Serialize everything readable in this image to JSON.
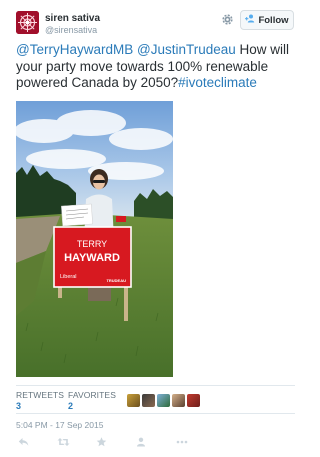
{
  "user": {
    "display_name": "siren sativa",
    "screen_name": "@sirensativa",
    "avatar_icon": "avatar-icon"
  },
  "header": {
    "settings_icon": "gear-icon",
    "follow_label": "Follow",
    "follow_icon": "add-user-icon"
  },
  "tweet": {
    "mention_1": "@TerryHaywardMB",
    "mention_2": "@JustinTrudeau",
    "body": " How will your party move towards 100% renewable powered Canada by 2050?",
    "hashtag": "#ivoteclimate"
  },
  "photo": {
    "sign_name_line1": "TERRY",
    "sign_name_line2": "HAYWARD",
    "sign_party": "Liberal",
    "sign_leader": "TRUDEAU",
    "sign_color": "#d71920"
  },
  "stats": {
    "retweets_label": "RETWEETS",
    "retweets_count": "3",
    "favorites_label": "FAVORITES",
    "favorites_count": "2"
  },
  "timestamp": "5:04 PM - 17 Sep 2015",
  "actions": [
    "reply-icon",
    "retweet-icon",
    "favorite-icon",
    "follow-icon",
    "more-icon"
  ],
  "colors": {
    "link": "#2b7bb9",
    "text": "#292f33",
    "muted": "#8899a6",
    "action_icon": "#ccd6dd"
  }
}
